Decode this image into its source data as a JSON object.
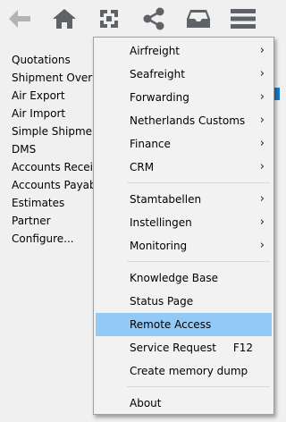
{
  "toolbar": {
    "icons": [
      "back-arrow-icon",
      "home-icon",
      "fullscreen-icon",
      "share-icon",
      "inbox-icon",
      "hamburger-menu-icon"
    ]
  },
  "sidebar": {
    "items": [
      {
        "label": "Quotations"
      },
      {
        "label": "Shipment Overview"
      },
      {
        "label": "Air Export"
      },
      {
        "label": "Air Import"
      },
      {
        "label": "Simple Shipments"
      },
      {
        "label": "DMS"
      },
      {
        "label": "Accounts Receivable"
      },
      {
        "label": "Accounts Payable"
      },
      {
        "label": "Estimates"
      },
      {
        "label": "Partner"
      },
      {
        "label": "Configure..."
      }
    ]
  },
  "menu": {
    "items": [
      {
        "label": "Airfreight",
        "submenu": true
      },
      {
        "label": "Seafreight",
        "submenu": true
      },
      {
        "label": "Forwarding",
        "submenu": true
      },
      {
        "label": "Netherlands Customs",
        "submenu": true
      },
      {
        "label": "Finance",
        "submenu": true
      },
      {
        "label": "CRM",
        "submenu": true
      },
      {
        "label": "Stamtabellen",
        "submenu": true
      },
      {
        "label": "Instellingen",
        "submenu": true
      },
      {
        "label": "Monitoring",
        "submenu": true
      },
      {
        "label": "Knowledge Base"
      },
      {
        "label": "Status Page"
      },
      {
        "label": "Remote Access",
        "highlighted": true
      },
      {
        "label": "Service Request",
        "shortcut": "F12"
      },
      {
        "label": "Create memory dump"
      },
      {
        "label": "About"
      }
    ],
    "arrow_glyph": "›",
    "highlight_color": "#91c9f7"
  }
}
